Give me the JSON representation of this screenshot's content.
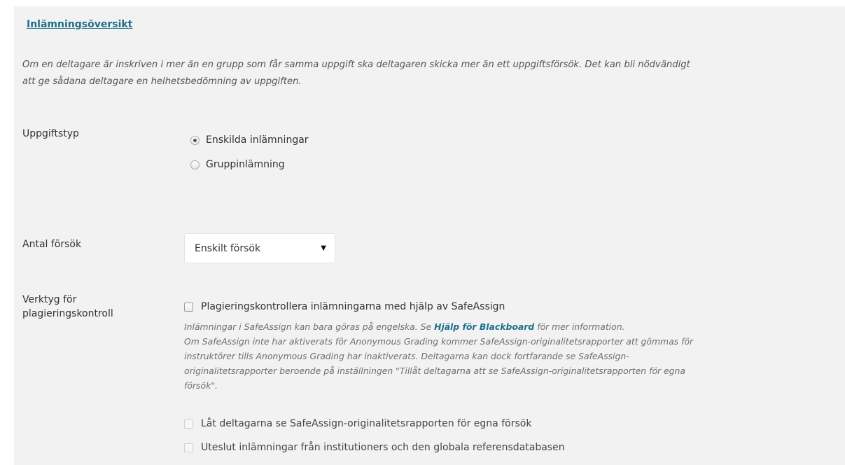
{
  "section": {
    "title": "Inlämningsöversikt",
    "intro_line1": "Om en deltagare är inskriven i mer än en grupp som får samma uppgift ska deltagaren skicka mer än ett uppgiftsförsök. Det kan bli nödvändigt",
    "intro_line2": "att ge sådana deltagare en helhetsbedömning av uppgiften."
  },
  "assignment_type": {
    "label": "Uppgiftstyp",
    "options": [
      {
        "label": "Enskilda inlämningar",
        "checked": true
      },
      {
        "label": "Gruppinlämning",
        "checked": false
      }
    ]
  },
  "attempts": {
    "label": "Antal försök",
    "selected": "Enskilt försök"
  },
  "plagiarism": {
    "label_line1": "Verktyg för",
    "label_line2": "plagieringskontroll",
    "main_check": "Plagieringskontrollera inlämningarna med hjälp av SafeAssign",
    "help_prefix": "Inlämningar i SafeAssign kan bara göras på engelska. Se ",
    "help_link": "Hjälp för Blackboard",
    "help_suffix": " för mer information.",
    "help_line2": "Om SafeAssign inte har aktiverats för Anonymous Grading kommer SafeAssign-originalitetsrapporter att gömmas för",
    "help_line3": "instruktörer tills Anonymous Grading har inaktiverats. Deltagarna kan dock fortfarande se SafeAssign-",
    "help_line4": "originalitetsrapporter beroende på inställningen \"Tillåt deltagarna att se SafeAssign-originalitetsrapporten för egna",
    "help_line5": "försök\".",
    "sub_check_1": "Låt deltagarna se SafeAssign-originalitetsrapporten för egna försök",
    "sub_check_2": "Uteslut inlämningar från institutioners och den globala referensdatabasen"
  }
}
